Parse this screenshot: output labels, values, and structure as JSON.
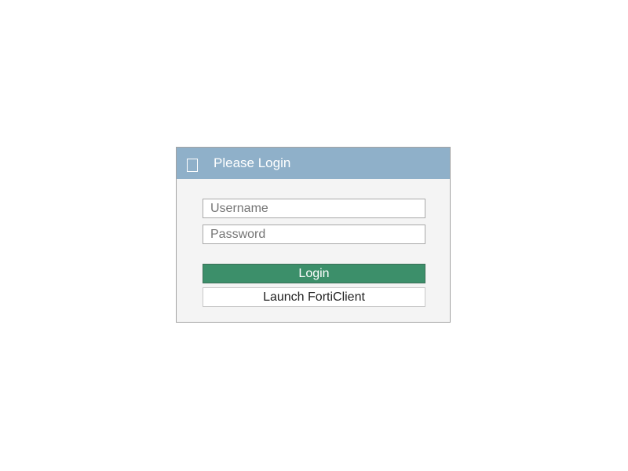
{
  "login_panel": {
    "header": {
      "icon": "lock-icon",
      "title": "Please Login"
    },
    "username": {
      "value": "",
      "placeholder": "Username"
    },
    "password": {
      "value": "",
      "placeholder": "Password"
    },
    "login_label": "Login",
    "forticlient_label": "Launch FortiClient"
  },
  "colors": {
    "header_bg": "#8fb0c9",
    "panel_bg": "#f4f4f4",
    "login_button_bg": "#3c8f6a",
    "page_bg": "#ffffff"
  }
}
